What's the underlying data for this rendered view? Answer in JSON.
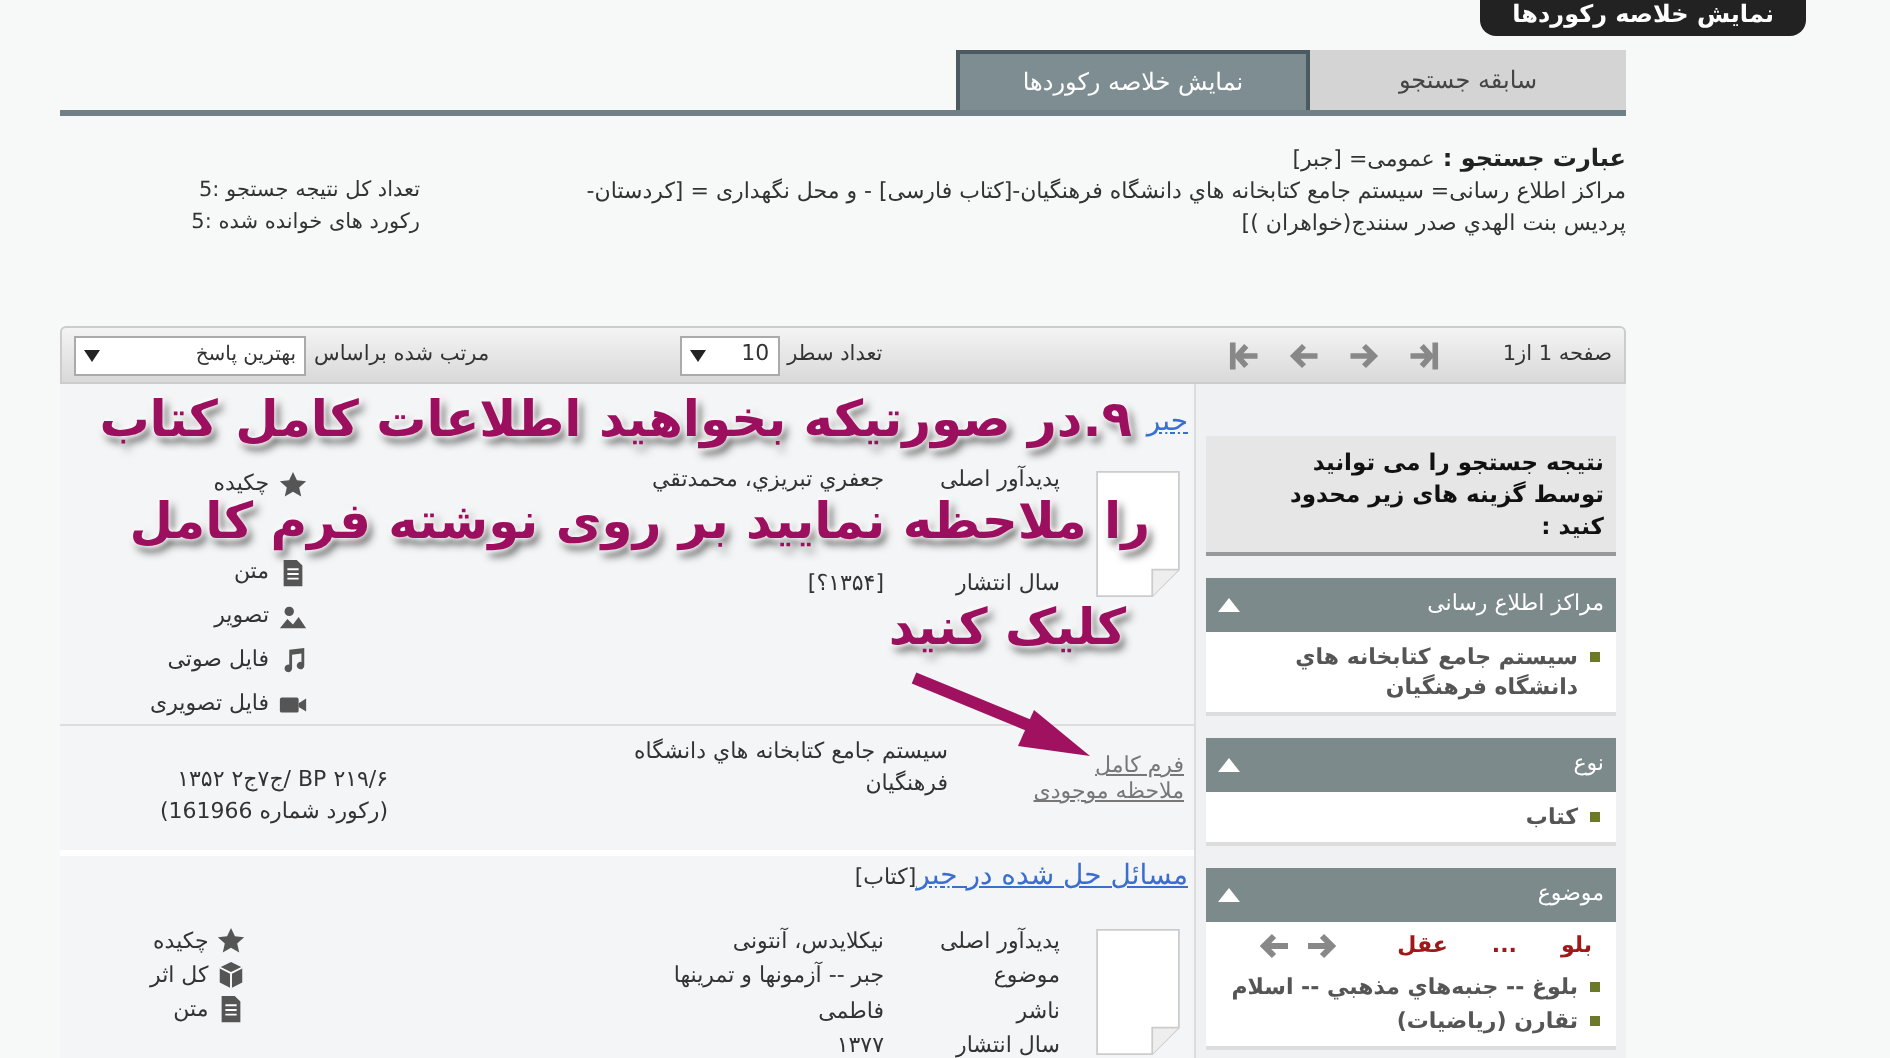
{
  "header_tab": "نمایش خلاصه رکوردها",
  "tabs": [
    {
      "label": "سابقه جستجو",
      "selected": false
    },
    {
      "label": "نمایش خلاصه رکوردها",
      "selected": true
    }
  ],
  "search_expression": {
    "label": "عبارت جستجو :",
    "query": "عمومی= [جبر]",
    "filters": "مراکز اطلاع رسانی= سیستم جامع کتابخانه هاي دانشگاه فرهنگيان-[کتاب فارسی] - و محل نگهداری = [کردستان-پردیس بنت الهدي صدر سنندج(خواهران )]"
  },
  "stats": [
    "تعداد کل نتیجه جستجو :5",
    "رکورد های خوانده شده :5"
  ],
  "toolbar": {
    "page_label": "صفحه 1 از1",
    "rows_label": "تعداد سطر",
    "rows_value": "10",
    "sort_label": "مرتب شده براساس",
    "sort_value": "بهترین پاسخ"
  },
  "records": [
    {
      "title": "جبر",
      "fields": [
        {
          "label": "پدیدآور اصلی",
          "value": "جعفري تبريزي، محمدتقي"
        },
        {
          "label": "سال انتشار",
          "value": "[۱۳۵۴؟]"
        }
      ],
      "resources": [
        {
          "kind": "star",
          "label": "چکیده"
        },
        {
          "kind": "doc",
          "label": "متن"
        },
        {
          "kind": "image",
          "label": "تصویر"
        },
        {
          "kind": "music",
          "label": "فایل صوتی"
        },
        {
          "kind": "video",
          "label": "فایل تصویری"
        }
      ],
      "holding": {
        "library": "سیستم جامع کتابخانه هاي دانشگاه فرهنگيان",
        "call_number": "BP ۲۱۹/۶ /ج۷ج۲ ۱۳۵۲",
        "record_number": "(رکورد شماره 161966)",
        "links": [
          "فرم کامل",
          "ملاحظه موجودی"
        ]
      }
    },
    {
      "title": "مسائل حل شده در جبر",
      "type": "[کتاب]",
      "fields": [
        {
          "label": "پدیدآور اصلی",
          "value": "نیکلایدس، آنتونی"
        },
        {
          "label": "موضوع",
          "value": "جبر -- آزمونها و تمرینها"
        },
        {
          "label": "ناشر",
          "value": "فاطمی"
        },
        {
          "label": "سال انتشار",
          "value": "۱۳۷۷"
        }
      ],
      "resources": [
        {
          "kind": "star",
          "label": "چکیده"
        },
        {
          "kind": "cube",
          "label": "کل اثر"
        },
        {
          "kind": "doc",
          "label": "متن"
        }
      ]
    }
  ],
  "sidebar": {
    "intro": "نتیجه جستجو را می توانید توسط گزینه های زیر محدود کنید :",
    "facets": [
      {
        "title": "مراکز اطلاع رسانی",
        "expanded": true,
        "items": [
          "سیستم جامع کتابخانه هاي دانشگاه فرهنگيان"
        ]
      },
      {
        "title": "نوع",
        "expanded": true,
        "items": [
          "کتاب"
        ]
      },
      {
        "title": "موضوع",
        "expanded": true,
        "pager": {
          "from": "بلو",
          "separator": "...",
          "to": "عقل"
        },
        "items": [
          "بلوغ -- جنبه‌هاي مذهبي -- اسلام",
          "تقارن (رياضيات)"
        ]
      }
    ]
  },
  "annotation": {
    "lines": [
      "۹.در صورتیکه بخواهید اطلاعات کامل کتاب",
      "را ملاحظه نمایید بر روی نوشته فرم کامل",
      "کلیک کنید"
    ]
  }
}
